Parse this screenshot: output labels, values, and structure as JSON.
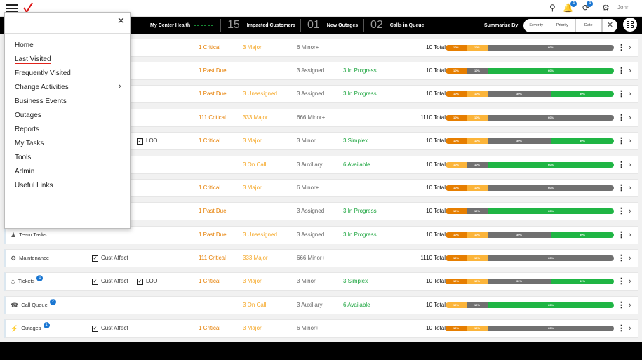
{
  "header": {
    "user": "John",
    "notif_count": "4",
    "sync_count": "4",
    "icons": [
      "search-icon",
      "bell-icon",
      "sync-icon",
      "user-settings-icon"
    ]
  },
  "status": {
    "health_label": "My Center Health",
    "impacted_count": "15",
    "impacted_label": "Impacted Customers",
    "outages_count": "01",
    "outages_label": "New Outages",
    "queue_count": "02",
    "queue_label": "Calls in Queue",
    "summarize_label": "Summarize By",
    "summarize_options": [
      "Severity",
      "Priority",
      "Date"
    ]
  },
  "menu": {
    "items": [
      {
        "label": "Home"
      },
      {
        "label": "Last Visited"
      },
      {
        "label": "Frequently Visited"
      },
      {
        "label": "Change Activities"
      },
      {
        "label": "Business Events"
      },
      {
        "label": "Outages"
      },
      {
        "label": "Reports"
      },
      {
        "label": "My Tasks"
      },
      {
        "label": "Tools"
      },
      {
        "label": "Admin"
      },
      {
        "label": "Useful Links"
      }
    ]
  },
  "colors": {
    "orange": "#e67e00",
    "amber": "#fbb43a",
    "gray": "#707070",
    "green": "#1fb544"
  },
  "rows": [
    {
      "name": "",
      "badge": "",
      "icon": "",
      "checks": [],
      "c1": "1 Critical",
      "c2": "3 Major",
      "c3": "6 Minor+",
      "c4": "",
      "total": "10 Total",
      "bar": [
        [
          "10%",
          10,
          "o"
        ],
        [
          "10%",
          10,
          "y"
        ],
        [
          "60%",
          60,
          "gr"
        ]
      ]
    },
    {
      "name": "",
      "badge": "",
      "icon": "",
      "checks": [],
      "c1": "1 Past Due",
      "c2": "",
      "c3": "3 Assigned",
      "c4": "3  In Progress",
      "total": "10 Total",
      "bar": [
        [
          "10%",
          10,
          "o"
        ],
        [
          "10%",
          10,
          "gr"
        ],
        [
          "60%",
          60,
          "g"
        ]
      ]
    },
    {
      "name": "",
      "badge": "",
      "icon": "",
      "checks": [],
      "c1": "1 Past Due",
      "c2": "3 Unassigned",
      "c3": "3 Assigned",
      "c4": "3  In Progress",
      "total": "10 Total",
      "bar": [
        [
          "10%",
          10,
          "o"
        ],
        [
          "10%",
          10,
          "y"
        ],
        [
          "30%",
          30,
          "gr"
        ],
        [
          "30%",
          30,
          "g"
        ]
      ]
    },
    {
      "name": "",
      "badge": "",
      "icon": "",
      "checks": [],
      "c1": "111 Critical",
      "c2": "333 Major",
      "c3": "666 Minor+",
      "c4": "",
      "total": "1110 Total",
      "bar": [
        [
          "10%",
          10,
          "o"
        ],
        [
          "10%",
          10,
          "y"
        ],
        [
          "60%",
          60,
          "gr"
        ]
      ]
    },
    {
      "name": "",
      "badge": "",
      "icon": "",
      "checks": [
        "LOD"
      ],
      "c1": "1 Critical",
      "c2": "3 Major",
      "c3": "3 Minor",
      "c4": "3 Simplex",
      "total": "10 Total",
      "bar": [
        [
          "10%",
          10,
          "o"
        ],
        [
          "10%",
          10,
          "y"
        ],
        [
          "30%",
          30,
          "gr"
        ],
        [
          "30%",
          30,
          "g"
        ]
      ]
    },
    {
      "name": "",
      "badge": "",
      "icon": "",
      "checks": [],
      "c1": "",
      "c2": "3  On Call",
      "c3": "3  Auxiliary",
      "c4": "6 Available",
      "total": "10 Total",
      "bar": [
        [
          "10%",
          10,
          "y"
        ],
        [
          "10%",
          10,
          "gr"
        ],
        [
          "60%",
          60,
          "g"
        ]
      ]
    },
    {
      "name": "",
      "badge": "",
      "icon": "",
      "checks": [],
      "c1": "1 Critical",
      "c2": "3 Major",
      "c3": "6 Minor+",
      "c4": "",
      "total": "10 Total",
      "bar": [
        [
          "10%",
          10,
          "o"
        ],
        [
          "10%",
          10,
          "y"
        ],
        [
          "60%",
          60,
          "gr"
        ]
      ]
    },
    {
      "name": "",
      "badge": "",
      "icon": "",
      "checks": [],
      "c1": "1 Past Due",
      "c2": "",
      "c3": "3 Assigned",
      "c4": "3  In Progress",
      "total": "10 Total",
      "bar": [
        [
          "10%",
          10,
          "o"
        ],
        [
          "10%",
          10,
          "gr"
        ],
        [
          "60%",
          60,
          "g"
        ]
      ]
    },
    {
      "name": "Team Tasks",
      "badge": "",
      "icon": "team-icon",
      "checks": [],
      "c1": "1 Past Due",
      "c2": "3 Unassigned",
      "c3": "3 Assigned",
      "c4": "3  In Progress",
      "total": "10 Total",
      "bar": [
        [
          "10%",
          10,
          "o"
        ],
        [
          "10%",
          10,
          "y"
        ],
        [
          "30%",
          30,
          "gr"
        ],
        [
          "30%",
          30,
          "g"
        ]
      ]
    },
    {
      "name": "Maintenance",
      "badge": "",
      "icon": "gear-icon",
      "checks": [
        "Cust Affect"
      ],
      "c1": "111 Critical",
      "c2": "333 Major",
      "c3": "666 Minor+",
      "c4": "",
      "total": "1110 Total",
      "bar": [
        [
          "10%",
          10,
          "o"
        ],
        [
          "10%",
          10,
          "y"
        ],
        [
          "60%",
          60,
          "gr"
        ]
      ]
    },
    {
      "name": "Tickets",
      "badge": "1",
      "icon": "ticket-icon",
      "checks": [
        "Cust Affect",
        "LOD"
      ],
      "c1": "1 Critical",
      "c2": "3 Major",
      "c3": "3 Minor",
      "c4": "3 Simplex",
      "total": "10 Total",
      "bar": [
        [
          "10%",
          10,
          "o"
        ],
        [
          "10%",
          10,
          "y"
        ],
        [
          "30%",
          30,
          "gr"
        ],
        [
          "30%",
          30,
          "g"
        ]
      ]
    },
    {
      "name": "Call Queue",
      "badge": "2",
      "icon": "phone-icon",
      "checks": [],
      "c1": "",
      "c2": "3  On Call",
      "c3": "3  Auxiliary",
      "c4": "6 Available",
      "total": "10 Total",
      "bar": [
        [
          "10%",
          10,
          "y"
        ],
        [
          "10%",
          10,
          "gr"
        ],
        [
          "60%",
          60,
          "g"
        ]
      ]
    },
    {
      "name": "Outages",
      "badge": "1",
      "icon": "outage-icon",
      "checks": [
        "Cust Affect"
      ],
      "c1": "1 Critical",
      "c2": "3 Major",
      "c3": "6 Minor+",
      "c4": "",
      "total": "10 Total",
      "bar": [
        [
          "10%",
          10,
          "o"
        ],
        [
          "10%",
          10,
          "y"
        ],
        [
          "60%",
          60,
          "gr"
        ]
      ]
    }
  ]
}
